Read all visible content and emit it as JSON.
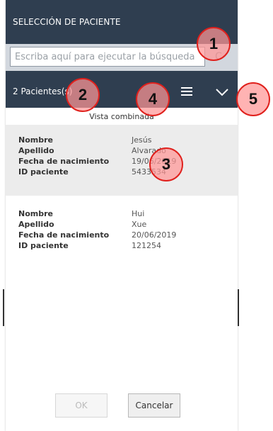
{
  "header": {
    "title": "SELECCIÓN DE PACIENTE",
    "count_label": "2 Pacientes(s)",
    "view_label": "Vista combinada"
  },
  "search": {
    "placeholder": "Escriba aquí para ejecutar la búsqueda"
  },
  "patients": [
    {
      "fields": [
        {
          "label": "Nombre",
          "value": "Jesús"
        },
        {
          "label": "Apellido",
          "value": "Alvarado"
        },
        {
          "label": "Fecha de nacimiento",
          "value": "19/06/2019"
        },
        {
          "label": "ID paciente",
          "value": "5433534"
        }
      ]
    },
    {
      "fields": [
        {
          "label": "Nombre",
          "value": "Hui"
        },
        {
          "label": "Apellido",
          "value": "Xue"
        },
        {
          "label": "Fecha de nacimiento",
          "value": "20/06/2019"
        },
        {
          "label": "ID paciente",
          "value": "121254"
        }
      ]
    }
  ],
  "footer": {
    "ok_label": "OK",
    "cancel_label": "Cancelar"
  },
  "callouts": [
    "1",
    "2",
    "3",
    "4",
    "5"
  ],
  "icons": {
    "search": "search-icon",
    "list": "list-view-icon",
    "expand": "chevron-down-icon"
  },
  "colors": {
    "header_bg": "#2f3e50",
    "selected_row_bg": "#ececec",
    "callout_fill": "#ff9696",
    "callout_stroke": "#e0201c"
  }
}
